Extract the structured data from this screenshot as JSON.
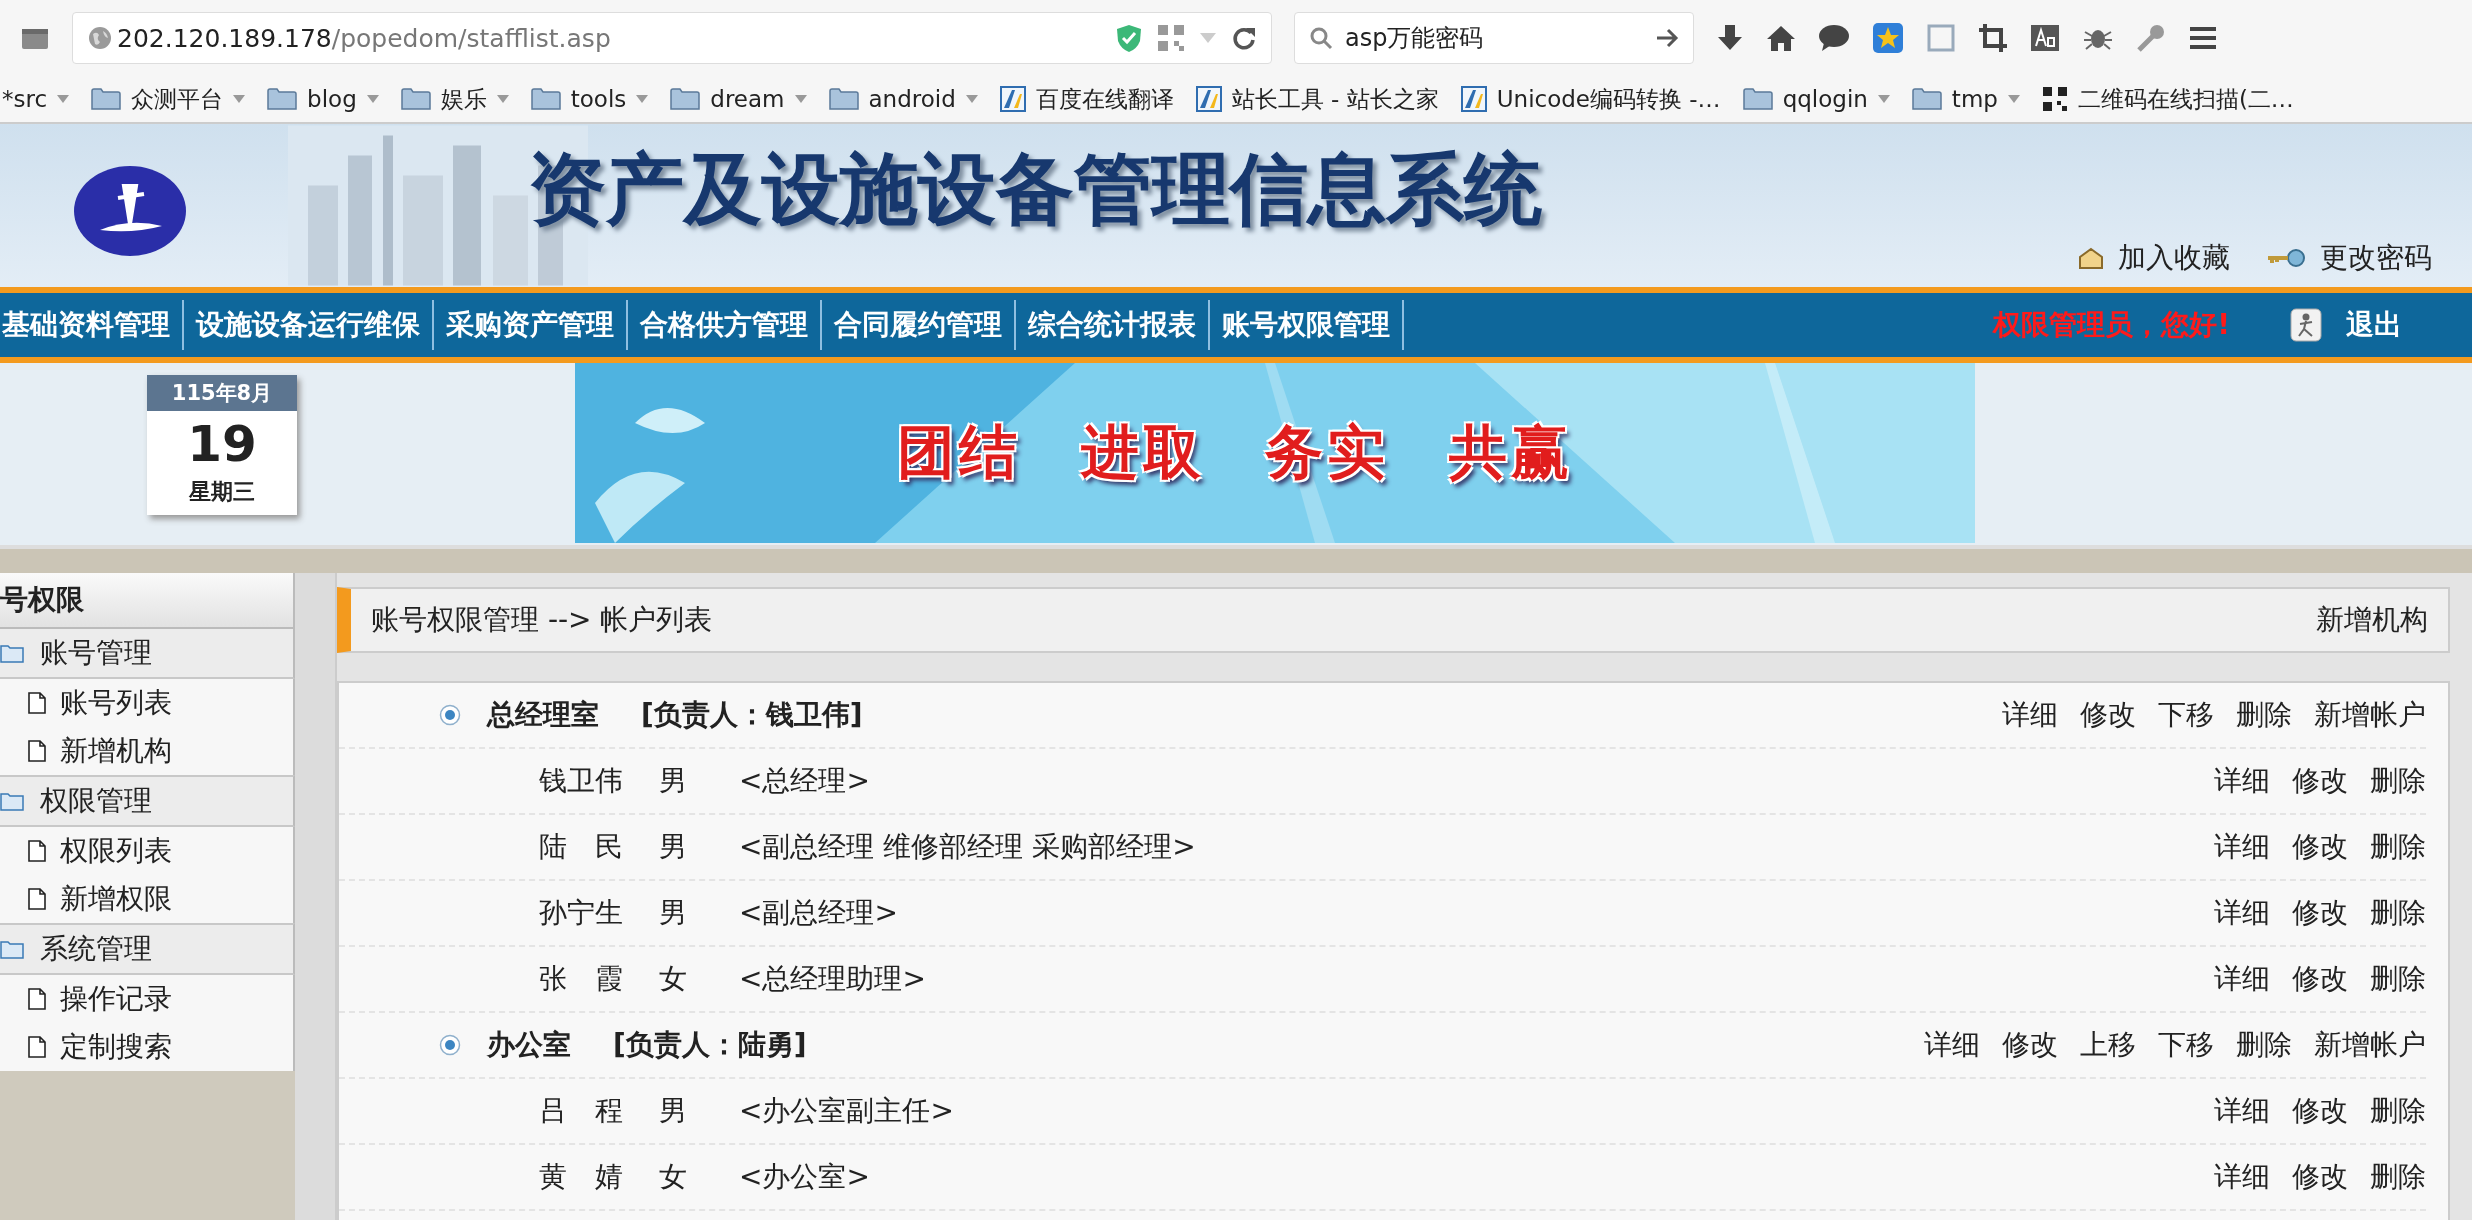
{
  "browser": {
    "url_host": "202.120.189.178",
    "url_path": "/popedom/stafflist.asp",
    "search": "asp万能密码",
    "bookmarks": [
      {
        "label": "*src",
        "kind": "plain"
      },
      {
        "label": "众测平台",
        "kind": "folder"
      },
      {
        "label": "blog",
        "kind": "folder"
      },
      {
        "label": "娱乐",
        "kind": "folder"
      },
      {
        "label": "tools",
        "kind": "folder"
      },
      {
        "label": "dream",
        "kind": "folder"
      },
      {
        "label": "android",
        "kind": "folder"
      },
      {
        "label": "百度在线翻译",
        "kind": "site"
      },
      {
        "label": "站长工具 - 站长之家",
        "kind": "site"
      },
      {
        "label": "Unicode编码转换 -…",
        "kind": "site"
      },
      {
        "label": "qqlogin",
        "kind": "folder"
      },
      {
        "label": "tmp",
        "kind": "folder"
      },
      {
        "label": "二维码在线扫描(二…",
        "kind": "qr"
      }
    ]
  },
  "header": {
    "title": "资产及设施设备管理信息系统",
    "links": [
      {
        "label": "加入收藏",
        "kind": "favorite"
      },
      {
        "label": "更改密码",
        "kind": "password"
      }
    ]
  },
  "nav": {
    "items": [
      "基础资料管理",
      "设施设备运行维保",
      "采购资产管理",
      "合格供方管理",
      "合同履约管理",
      "综合统计报表",
      "账号权限管理"
    ],
    "greeting": "权限管理员，您好!",
    "logout": "退出"
  },
  "date": {
    "month": "115年8月",
    "day": "19",
    "weekday": "星期三"
  },
  "slogan": [
    "团结",
    "进取",
    "务实",
    "共赢"
  ],
  "sidebar": {
    "title": "号权限",
    "groups": [
      {
        "label": "账号管理",
        "items": [
          "账号列表",
          "新增机构"
        ]
      },
      {
        "label": "权限管理",
        "items": [
          "权限列表",
          "新增权限"
        ]
      },
      {
        "label": "系统管理",
        "items": [
          "操作记录",
          "定制搜索"
        ]
      }
    ]
  },
  "breadcrumb": {
    "path": "账号权限管理 --> 帐户列表",
    "action": "新增机构"
  },
  "rows": [
    {
      "kind": "department",
      "name": "总经理室",
      "head": "[负责人：钱卫伟]",
      "actions": [
        "详细",
        "修改",
        "下移",
        "删除",
        "新增帐户"
      ]
    },
    {
      "kind": "staff",
      "name": "钱卫伟",
      "gender": "男",
      "title": "<总经理>",
      "actions": [
        "详细",
        "修改",
        "删除"
      ]
    },
    {
      "kind": "staff",
      "name": "陆　民",
      "gender": "男",
      "title": "<副总经理 维修部经理 采购部经理>",
      "actions": [
        "详细",
        "修改",
        "删除"
      ]
    },
    {
      "kind": "staff",
      "name": "孙宁生",
      "gender": "男",
      "title": "<副总经理>",
      "actions": [
        "详细",
        "修改",
        "删除"
      ]
    },
    {
      "kind": "staff",
      "name": "张　霞",
      "gender": "女",
      "title": "<总经理助理>",
      "actions": [
        "详细",
        "修改",
        "删除"
      ]
    },
    {
      "kind": "department",
      "name": "办公室",
      "head": "[负责人：陆勇]",
      "actions": [
        "详细",
        "修改",
        "上移",
        "下移",
        "删除",
        "新增帐户"
      ]
    },
    {
      "kind": "staff",
      "name": "吕　程",
      "gender": "男",
      "title": "<办公室副主任>",
      "actions": [
        "详细",
        "修改",
        "删除"
      ]
    },
    {
      "kind": "staff",
      "name": "黄　婧",
      "gender": "女",
      "title": "<办公室>",
      "actions": [
        "详细",
        "修改",
        "删除"
      ]
    }
  ]
}
